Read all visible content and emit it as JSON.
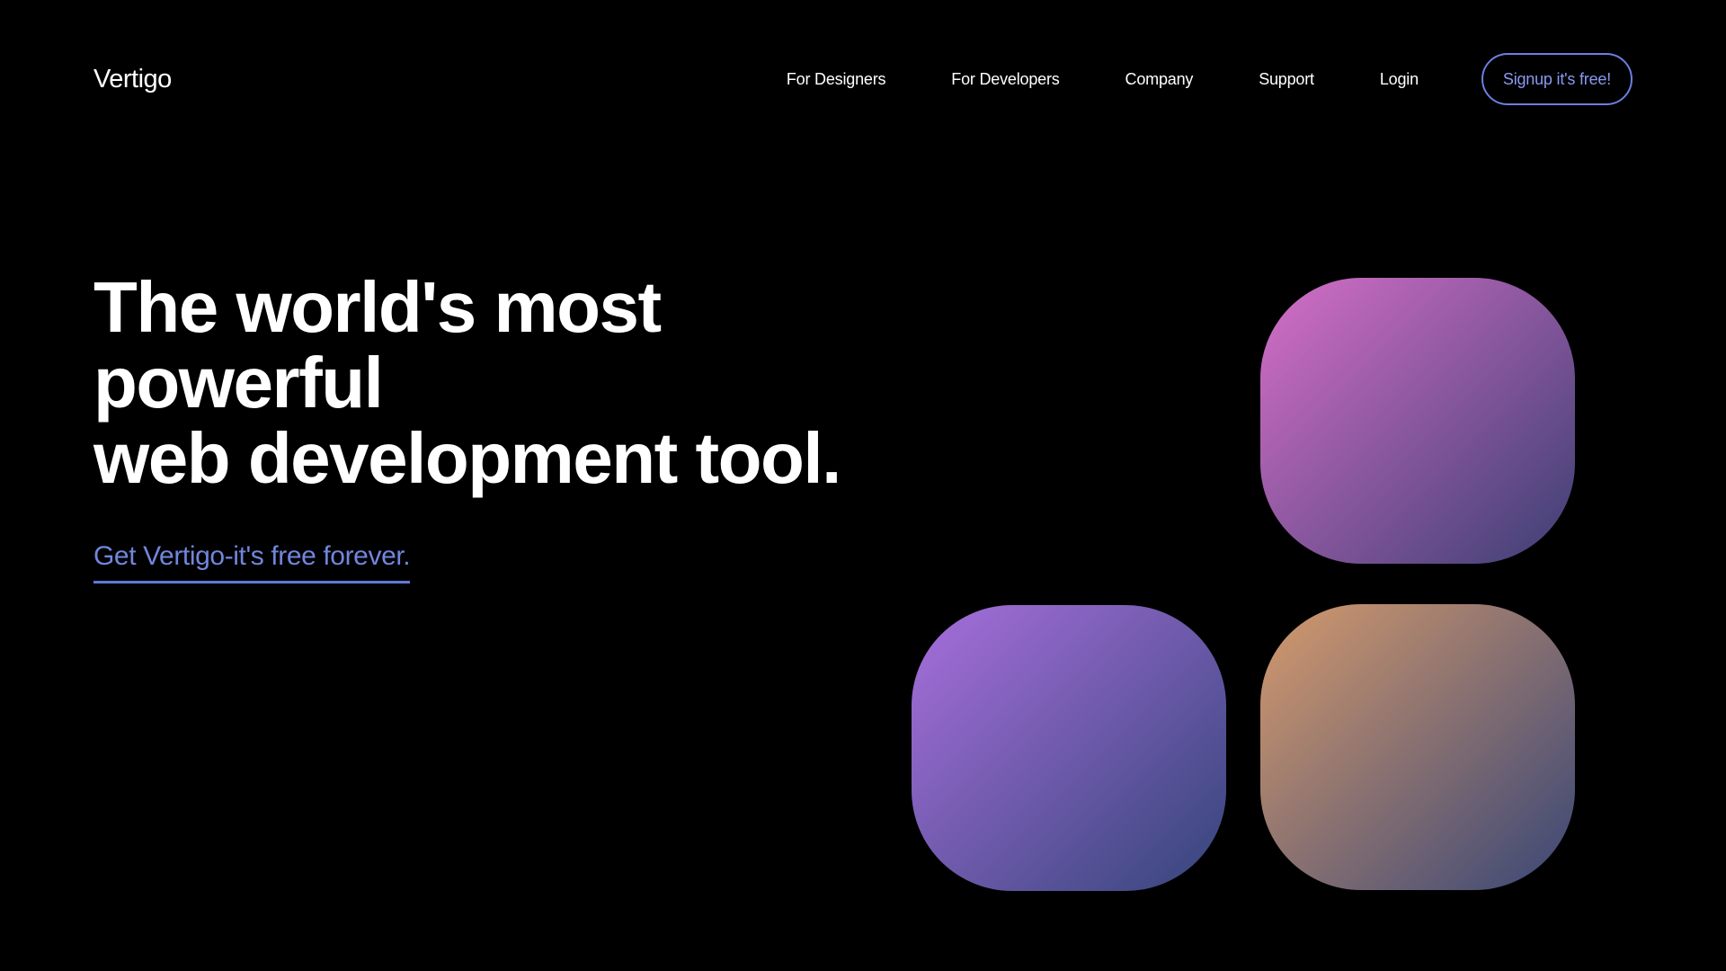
{
  "header": {
    "logo": "Vertigo",
    "nav_items": [
      {
        "label": "For Designers"
      },
      {
        "label": "For Developers"
      },
      {
        "label": "Company"
      },
      {
        "label": "Support"
      },
      {
        "label": "Login"
      }
    ],
    "signup_label": "Signup it's free!"
  },
  "hero": {
    "headline_line1": "The world's most powerful",
    "headline_line2": "web development tool.",
    "cta_label": "Get Vertigo-it's free forever."
  },
  "colors": {
    "background": "#000000",
    "text": "#ffffff",
    "accent": "#7186dc",
    "tile_top_gradient": [
      "#d66fc8",
      "#3c3f73"
    ],
    "tile_bottom_left_gradient": [
      "#a86fdc",
      "#34457a"
    ],
    "tile_bottom_right_gradient": [
      "#d59a6c",
      "#394676"
    ]
  }
}
